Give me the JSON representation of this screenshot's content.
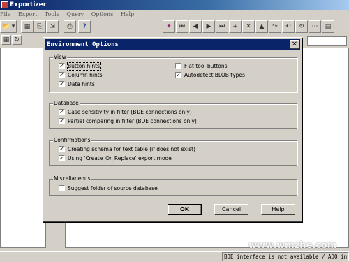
{
  "app": {
    "title": "Exportizer"
  },
  "menu": [
    "File",
    "Export",
    "Tools",
    "Query",
    "Options",
    "Help"
  ],
  "toolbar_icons": [
    "open-icon",
    "dropdown-icon",
    "grid-icon",
    "copy-icon",
    "export-icon",
    "print-icon",
    "help-icon",
    "connect-icon",
    "first-icon",
    "prior-icon",
    "next-icon",
    "last-icon",
    "insert-icon",
    "delete-icon",
    "up-icon",
    "cancel-icon",
    "undo-icon",
    "refresh-icon",
    "more-icon",
    "extra-icon"
  ],
  "dialog": {
    "title": "Environment Options",
    "close_glyph": "✕",
    "groups": {
      "view": {
        "label": "View",
        "options": [
          {
            "label": "Button hints",
            "checked": true
          },
          {
            "label": "Column hints",
            "checked": true
          },
          {
            "label": "Data hints",
            "checked": true
          },
          {
            "label": "Flat tool buttons",
            "checked": false
          },
          {
            "label": "Autodetect BLOB types",
            "checked": true
          }
        ]
      },
      "database": {
        "label": "Database",
        "options": [
          {
            "label": "Case sensitivity in filter (BDE connections only)",
            "checked": true
          },
          {
            "label": "Partial comparing in filter (BDE connections only)",
            "checked": true
          }
        ]
      },
      "confirmations": {
        "label": "Confirmations",
        "options": [
          {
            "label": "Creating schema for text table (if does not exist)",
            "checked": true
          },
          {
            "label": "Using 'Create_Or_Replace' export mode",
            "checked": true
          }
        ]
      },
      "misc": {
        "label": "Miscellaneous",
        "options": [
          {
            "label": "Suggest folder of source database",
            "checked": false
          }
        ]
      }
    },
    "buttons": {
      "ok": "OK",
      "cancel": "Cancel",
      "help": "Help"
    }
  },
  "status": {
    "text": "BDE interface is not available / ADO int"
  },
  "watermark": "www.wmzhe.com",
  "colors": {
    "title_bar": "#0a246a",
    "face": "#d4d0c8"
  }
}
